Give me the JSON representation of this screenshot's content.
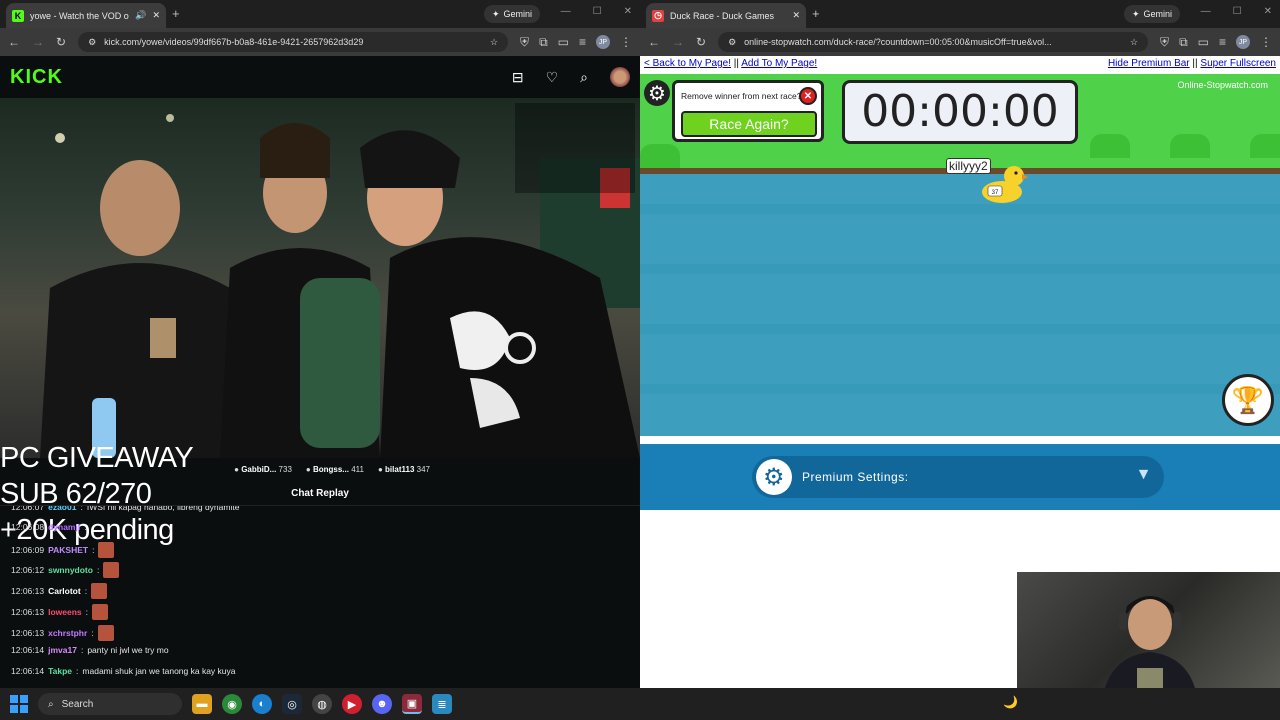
{
  "left_window": {
    "tab_title": "yowe - Watch the VOD on K",
    "gemini_label": "Gemini",
    "url": "kick.com/yowe/videos/99df667b-b0a8-461e-9421-2657962d3d29",
    "site_logo": "KICK",
    "overlay_lines": [
      "PC GIVEAWAY",
      "SUB 62/270",
      "+20K pending"
    ],
    "leaderboard": [
      {
        "name": "GabbiD...",
        "value": "733"
      },
      {
        "name": "Bongss...",
        "value": "411"
      },
      {
        "name": "bilat113",
        "value": "347"
      }
    ],
    "chat_header": "Chat Replay",
    "chat": [
      {
        "time": "12:06:07",
        "user": "ezao01",
        "color": "#57d0ff",
        "text": "IWSI nil kapag hanabo, ilbreng dynamite",
        "emote": false
      },
      {
        "time": "12:06:08",
        "user": "dynamji",
        "color": "#b16bff",
        "text": "",
        "emote": false
      },
      {
        "time": "12:06:09",
        "user": "PAKSHET",
        "color": "#c28cff",
        "text": "",
        "emote": true
      },
      {
        "time": "12:06:12",
        "user": "swnnydoto",
        "color": "#5ee0a0",
        "text": "",
        "emote": true
      },
      {
        "time": "12:06:13",
        "user": "Carlotot",
        "color": "#ffffff",
        "text": "",
        "emote": true
      },
      {
        "time": "12:06:13",
        "user": "loweens",
        "color": "#ff4b6e",
        "text": "",
        "emote": true
      },
      {
        "time": "12:06:13",
        "user": "xchrstphr",
        "color": "#c07bff",
        "text": "",
        "emote": true
      },
      {
        "time": "12:06:14",
        "user": "jmva17",
        "color": "#d98cff",
        "text": "panty ni jwl we try mo",
        "emote": false
      },
      {
        "time": "12:06:14",
        "user": "Takpe",
        "color": "#5ee0a0",
        "text": "madami shuk jan we tanong ka kay kuya",
        "emote": false
      }
    ]
  },
  "right_window": {
    "tab_title": "Duck Race - Duck Games",
    "gemini_label": "Gemini",
    "url": "online-stopwatch.com/duck-race/?countdown=00:05:00&musicOff=true&vol...",
    "links": {
      "back": "< Back to My Page!",
      "sep": "||",
      "add": "Add To My Page!",
      "hide": "Hide Premium Bar",
      "fullscreen": "Super Fullscreen"
    },
    "remove_winner_label": "Remove winner from next race?",
    "race_again": "Race Again?",
    "timer": "00:00:00",
    "brand": "Online-Stopwatch.com",
    "duck_name": "killyyy2",
    "duck_number": "37",
    "premium_label": "Premium Settings:"
  },
  "taskbar": {
    "search_placeholder": "Search"
  },
  "colors": {
    "kick_green": "#53fc18",
    "grass": "#4fd14a",
    "water": "#3d9fbd",
    "premium_blue": "#1a7fb6"
  }
}
